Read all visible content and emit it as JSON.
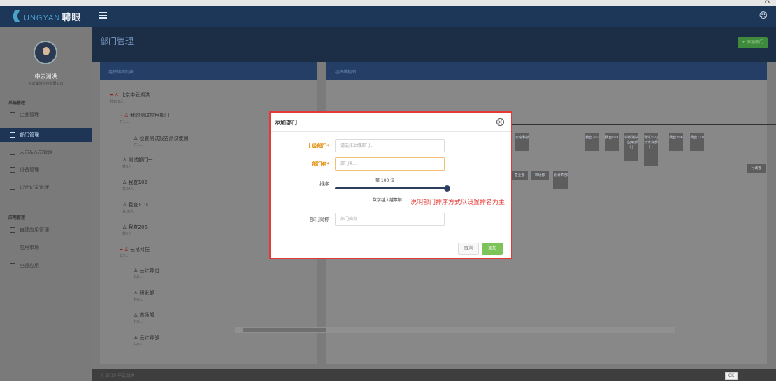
{
  "topbar": {
    "tab_title": "",
    "right_text": "CK"
  },
  "navbar": {
    "brand_en": "UNGYAN",
    "brand_cn": "聘眼",
    "user_icon": "user-icon"
  },
  "sidebar": {
    "user_name": "中云湖洪",
    "org_name": "中云湖洪科技有限公司",
    "sections": [
      {
        "title": "系统管理",
        "items": [
          "企业管理",
          "部门管理",
          "人员&人员管理",
          "设备管理",
          "识别记录管理"
        ]
      },
      {
        "title": "应用管理",
        "items": [
          "自建应用管理",
          "应用市场",
          "全部应用"
        ]
      }
    ],
    "active": "部门管理"
  },
  "page": {
    "title": "部门管理",
    "add_button": "+ 添加部门"
  },
  "left_panel": {
    "title": "组织结构列表",
    "tree": [
      {
        "name": "北京中云湖洪",
        "count": "共100人"
      },
      {
        "name": "我的测试应用部门",
        "count": "共1人"
      },
      {
        "name": "设置测试报告测试使用",
        "count": "共1人"
      },
      {
        "name": "测试部门一",
        "count": "共3人"
      },
      {
        "name": "我查102",
        "count": "共20人"
      },
      {
        "name": "我查110",
        "count": "共20人"
      },
      {
        "name": "我查206",
        "count": "共5人"
      },
      {
        "name": "云帛科技",
        "count": "共3人"
      },
      {
        "name": "云计算组",
        "count": "共0人"
      },
      {
        "name": "研发部",
        "count": "共0人"
      },
      {
        "name": "市场部",
        "count": "共0人"
      },
      {
        "name": "云计算部",
        "count": "共0人"
      }
    ]
  },
  "right_panel": {
    "title": "组织结构图",
    "org_boxes": [
      "云帛科技",
      "我查203",
      "我查101",
      "学校测试1应用部门",
      "测试公司云计算部门",
      "我查206",
      "我查110",
      "营业部",
      "市场部",
      "云计算部",
      "行政部"
    ]
  },
  "modal": {
    "title": "添加部门",
    "fields": {
      "parent": {
        "label": "上级部门*",
        "placeholder": "请选择上级部门..."
      },
      "name": {
        "label": "部门名*",
        "placeholder": "部门名..."
      },
      "order": {
        "label": "排序",
        "value_text": "第 100 位",
        "hint": "数字越大越靠前"
      },
      "short": {
        "label": "部门简称",
        "placeholder": "部门简称..."
      }
    },
    "annotation": "说明部门排序方式以设置排名为主",
    "cancel": "取消",
    "submit": "添加"
  },
  "footer": {
    "copyright": "© 2019 中云湖洪",
    "badge": "CK"
  }
}
